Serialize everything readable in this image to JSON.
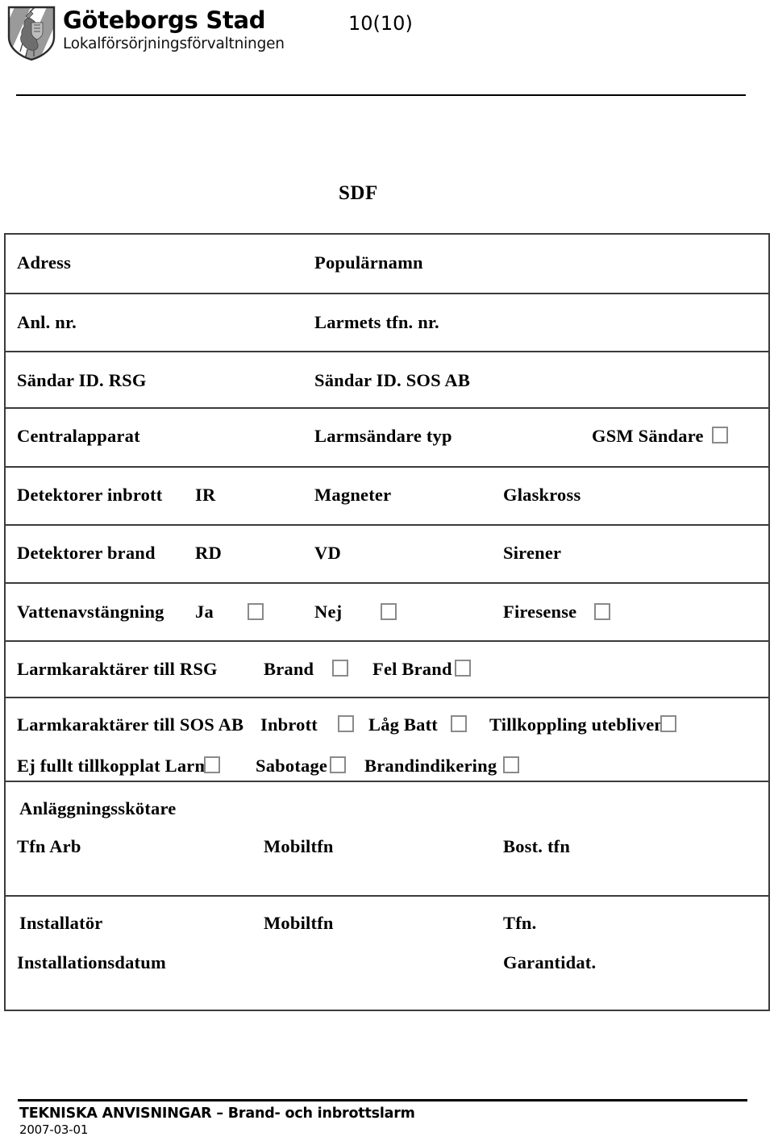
{
  "header": {
    "logo_icon": "gothenburg-coat-of-arms",
    "organization": "Göteborgs Stad",
    "department": "Lokalförsörjningsförvaltningen",
    "page_number": "10(10)"
  },
  "document": {
    "section_title": "SDF"
  },
  "form": {
    "rows": [
      {
        "id": "adress",
        "fields": [
          {
            "label": "Adress",
            "col": 1
          },
          {
            "label": "Populärnamn",
            "col": 2
          }
        ]
      },
      {
        "id": "anl-nr",
        "fields": [
          {
            "label": "Anl. nr.",
            "col": 1
          },
          {
            "label": "Larmets tfn. nr.",
            "col": 2
          }
        ]
      },
      {
        "id": "sandar-id",
        "fields": [
          {
            "label": "Sändar ID. RSG",
            "col": 1
          },
          {
            "label": "Sändar ID. SOS  AB",
            "col": 2
          }
        ]
      },
      {
        "id": "centralapparat",
        "fields": [
          {
            "label": "Centralapparat",
            "col": 1
          },
          {
            "label": "Larmsändare typ",
            "col": 2
          },
          {
            "label": "GSM Sändare",
            "col": 3,
            "checkbox": true
          }
        ]
      },
      {
        "id": "detektorer-inbrott",
        "fields": [
          {
            "label": "Detektorer inbrott",
            "col": 1
          },
          {
            "label": "IR",
            "col": 1
          },
          {
            "label": "Magneter",
            "col": 2
          },
          {
            "label": "Glaskross",
            "col": 3
          }
        ]
      },
      {
        "id": "detektorer-brand",
        "fields": [
          {
            "label": "Detektorer brand",
            "col": 1
          },
          {
            "label": "RD",
            "col": 1
          },
          {
            "label": "VD",
            "col": 2
          },
          {
            "label": "Sirener",
            "col": 3
          }
        ]
      },
      {
        "id": "vattenavstangning",
        "fields": [
          {
            "label": "Vattenavstängning",
            "col": 1
          },
          {
            "label": "Ja",
            "col": 1,
            "checkbox": true
          },
          {
            "label": "Nej",
            "col": 2,
            "checkbox": true
          },
          {
            "label": "Firesense",
            "col": 3,
            "checkbox": true
          }
        ]
      },
      {
        "id": "larmkaraktarer-rsg",
        "fields": [
          {
            "label": "Larmkaraktärer till RSG",
            "col": 1
          },
          {
            "label": "Brand",
            "col": 2,
            "checkbox": true
          },
          {
            "label": "Fel Brand",
            "col": 2,
            "checkbox": true
          }
        ]
      },
      {
        "id": "larmkaraktarer-sos",
        "fields": [
          {
            "label": "Larmkaraktärer till SOS AB",
            "col": 1
          },
          {
            "label": "Inbrott",
            "col": 2,
            "checkbox": true
          },
          {
            "label": "Låg Batt",
            "col": 2,
            "checkbox": true
          },
          {
            "label": "Tillkoppling utebliven",
            "col": 3,
            "checkbox": true
          },
          {
            "label": "Ej fullt tillkopplat Larm",
            "col": 1,
            "checkbox": true
          },
          {
            "label": "Sabotage",
            "col": 2,
            "checkbox": true
          },
          {
            "label": "Brandindikering",
            "col": 2,
            "checkbox": true
          }
        ]
      },
      {
        "id": "anlaggningsskotare",
        "fields": [
          {
            "label": "Anläggningsskötare",
            "col": 1
          },
          {
            "label": "Tfn Arb",
            "col": 1
          },
          {
            "label": "Mobiltfn",
            "col": 2
          },
          {
            "label": "Bost. tfn",
            "col": 3
          }
        ]
      },
      {
        "id": "installator",
        "fields": [
          {
            "label": "Installatör",
            "col": 1
          },
          {
            "label": "Mobiltfn",
            "col": 2
          },
          {
            "label": "Tfn.",
            "col": 3
          },
          {
            "label": "Installationsdatum",
            "col": 1
          },
          {
            "label": "Garantidat.",
            "col": 3
          }
        ]
      }
    ],
    "labels": {
      "adress": "Adress",
      "popularnamn": "Populärnamn",
      "anl_nr": "Anl. nr.",
      "larmets_tfn_nr": "Larmets tfn. nr.",
      "sandar_id_rsg": "Sändar ID. RSG",
      "sandar_id_sos_ab": "Sändar ID. SOS  AB",
      "centralapparat": "Centralapparat",
      "larmsandare_typ": "Larmsändare typ",
      "gsm_sandare": "GSM Sändare",
      "detektorer_inbrott": "Detektorer inbrott",
      "ir": "IR",
      "magneter": "Magneter",
      "glaskross": "Glaskross",
      "detektorer_brand": "Detektorer brand",
      "rd": "RD",
      "vd": "VD",
      "sirener": "Sirener",
      "vattenavstangning": "Vattenavstängning",
      "ja": "Ja",
      "nej": "Nej",
      "firesense": "Firesense",
      "larmkaraktarer_till_rsg": "Larmkaraktärer till RSG",
      "brand": "Brand",
      "fel_brand": "Fel Brand",
      "larmkaraktarer_till_sos_ab": "Larmkaraktärer till SOS AB",
      "inbrott": "Inbrott",
      "lag_batt": "Låg Batt",
      "tillkoppling_utebliven": "Tillkoppling utebliven",
      "ej_fullt_tillkopplat_larm": "Ej fullt tillkopplat Larm",
      "sabotage": "Sabotage",
      "brandindikering": "Brandindikering",
      "anlaggningsskotare": "Anläggningsskötare",
      "tfn_arb": "Tfn Arb",
      "mobiltfn": "Mobiltfn",
      "bost_tfn": "Bost. tfn",
      "installator": "Installatör",
      "mobiltfn_2": "Mobiltfn",
      "tfn": "Tfn.",
      "installationsdatum": "Installationsdatum",
      "garantidat": "Garantidat."
    }
  },
  "footer": {
    "title": "TEKNISKA ANVISNINGAR – Brand- och inbrottslarm",
    "date": "2007-03-01"
  },
  "colors": {
    "text": "#000000",
    "table_border": "#3b3b3b",
    "checkbox_border": "#8a8a8a",
    "page_background": "#ffffff"
  }
}
